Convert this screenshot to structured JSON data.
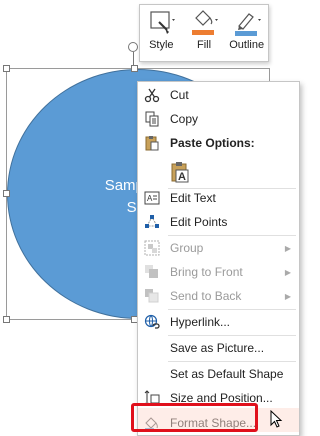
{
  "shape": {
    "text_line1": "Sample Te",
    "text_line2": "Sha"
  },
  "mini_toolbar": {
    "style_label": "Style",
    "fill_label": "Fill",
    "outline_label": "Outline",
    "fill_color": "#ed7d31",
    "outline_color": "#5b9bd5"
  },
  "context_menu": {
    "items": {
      "cut": "Cut",
      "copy": "Copy",
      "paste_options": "Paste Options:",
      "edit_text": "Edit Text",
      "edit_points": "Edit Points",
      "group": "Group",
      "bring_to_front": "Bring to Front",
      "send_to_back": "Send to Back",
      "hyperlink": "Hyperlink...",
      "save_as_picture": "Save as Picture...",
      "set_default_shape": "Set as Default Shape",
      "size_and_position": "Size and Position...",
      "format_shape": "Format Shape..."
    },
    "highlight_color": "#e0101c"
  }
}
